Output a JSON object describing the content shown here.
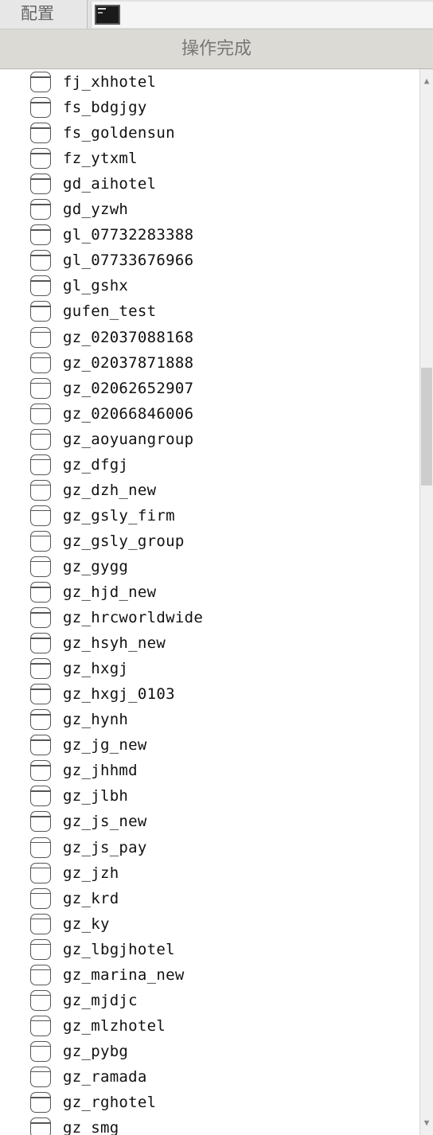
{
  "toolbar": {
    "config_tab_label": "配置",
    "terminal_icon": "terminal-icon"
  },
  "status": {
    "message": "操作完成"
  },
  "databases": [
    "fj_xhhotel",
    "fs_bdgjgy",
    "fs_goldensun",
    "fz_ytxml",
    "gd_aihotel",
    "gd_yzwh",
    "gl_07732283388",
    "gl_07733676966",
    "gl_gshx",
    "gufen_test",
    "gz_02037088168",
    "gz_02037871888",
    "gz_02062652907",
    "gz_02066846006",
    "gz_aoyuangroup",
    "gz_dfgj",
    "gz_dzh_new",
    "gz_gsly_firm",
    "gz_gsly_group",
    "gz_gygg",
    "gz_hjd_new",
    "gz_hrcworldwide",
    "gz_hsyh_new",
    "gz_hxgj",
    "gz_hxgj_0103",
    "gz_hynh",
    "gz_jg_new",
    "gz_jhhmd",
    "gz_jlbh",
    "gz_js_new",
    "gz_js_pay",
    "gz_jzh",
    "gz_krd",
    "gz_ky",
    "gz_lbgjhotel",
    "gz_marina_new",
    "gz_mjdjc",
    "gz_mlzhotel",
    "gz_pybg",
    "gz_ramada",
    "gz_rghotel",
    "gz_smg"
  ],
  "icons": {
    "database": "database-icon",
    "scroll_up": "scroll-up-arrow-icon",
    "scroll_down": "scroll-down-arrow-icon"
  }
}
